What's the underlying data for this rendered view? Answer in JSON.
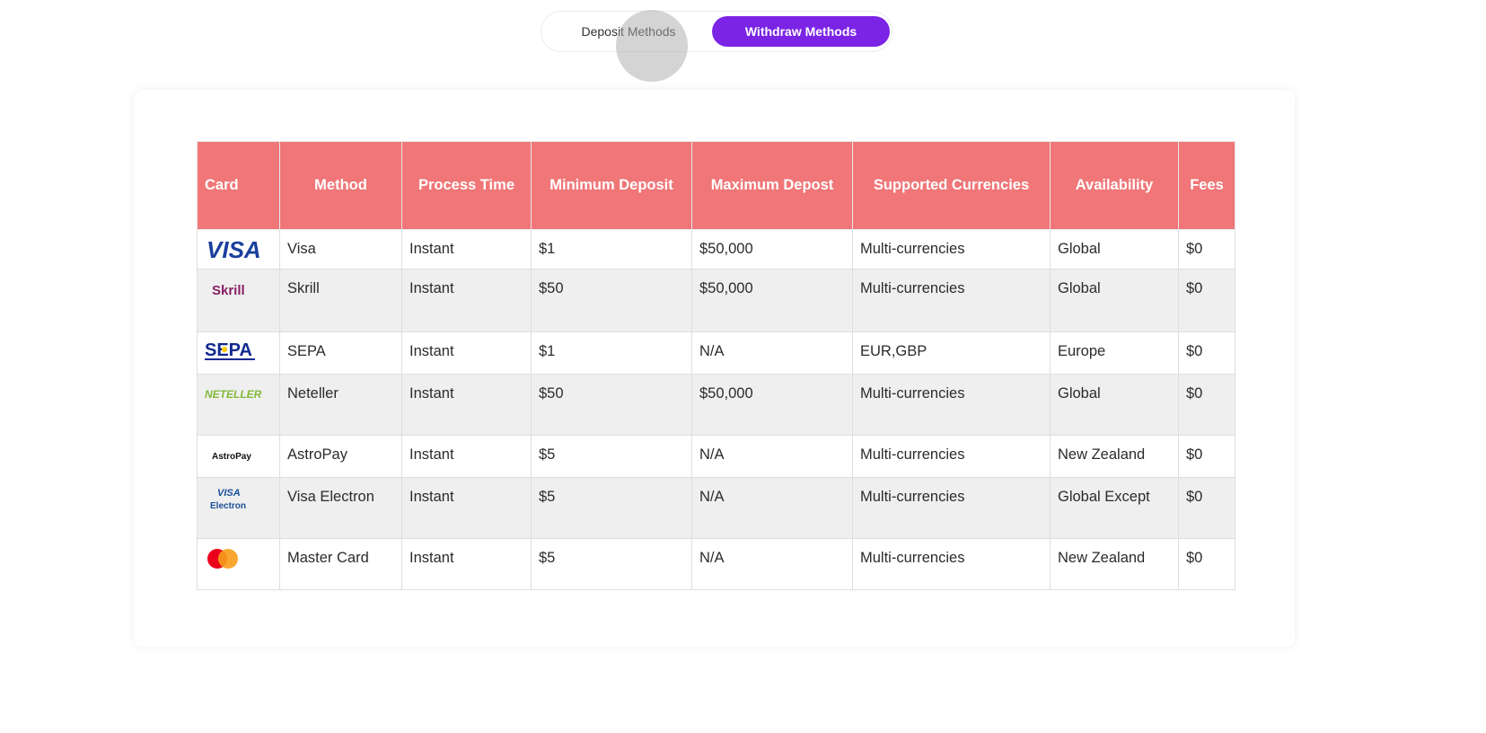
{
  "tabs": {
    "deposit_label": "Deposit Methods",
    "withdraw_label": "Withdraw Methods",
    "active": "withdraw",
    "active_color": "#7b24e6"
  },
  "table": {
    "header_color": "#f07678",
    "headers": [
      "Card",
      "Method",
      "Process Time",
      "Minimum Deposit",
      "Maximum Depost",
      "Supported Currencies",
      "Availability",
      "Fees"
    ],
    "rows": [
      {
        "logo": "visa-logo",
        "logo_text": "VISA",
        "method": "Visa",
        "process_time": "Instant",
        "min": "$1",
        "max": "$50,000",
        "currencies": "Multi-currencies",
        "availability": "Global",
        "fees": "$0"
      },
      {
        "logo": "skrill-logo",
        "logo_text": "Skrill",
        "method": "Skrill",
        "process_time": "Instant",
        "min": "$50",
        "max": "$50,000",
        "currencies": "Multi-currencies",
        "availability": "Global",
        "fees": "$0"
      },
      {
        "logo": "sepa-logo",
        "logo_text": "SEPA",
        "method": "SEPA",
        "process_time": "Instant",
        "min": "$1",
        "max": "N/A",
        "currencies": "EUR,GBP",
        "availability": "Europe",
        "fees": "$0"
      },
      {
        "logo": "neteller-logo",
        "logo_text": "NETELLER",
        "method": "Neteller",
        "process_time": "Instant",
        "min": "$50",
        "max": "$50,000",
        "currencies": "Multi-currencies",
        "availability": "Global",
        "fees": "$0"
      },
      {
        "logo": "astropay-logo",
        "logo_text": "AstroPay",
        "method": "AstroPay",
        "process_time": "Instant",
        "min": "$5",
        "max": "N/A",
        "currencies": "Multi-currencies",
        "availability": "New Zealand",
        "fees": "$0"
      },
      {
        "logo": "visa-electron-logo",
        "logo_text": "VISA Electron",
        "method": "Visa Electron",
        "process_time": "Instant",
        "min": "$5",
        "max": "N/A",
        "currencies": "Multi-currencies",
        "availability": "Global Except",
        "fees": "$0"
      },
      {
        "logo": "mastercard-logo",
        "logo_text": "",
        "method": "Master Card",
        "process_time": "Instant",
        "min": "$5",
        "max": "N/A",
        "currencies": "Multi-currencies",
        "availability": "New Zealand",
        "fees": "$0"
      }
    ]
  }
}
